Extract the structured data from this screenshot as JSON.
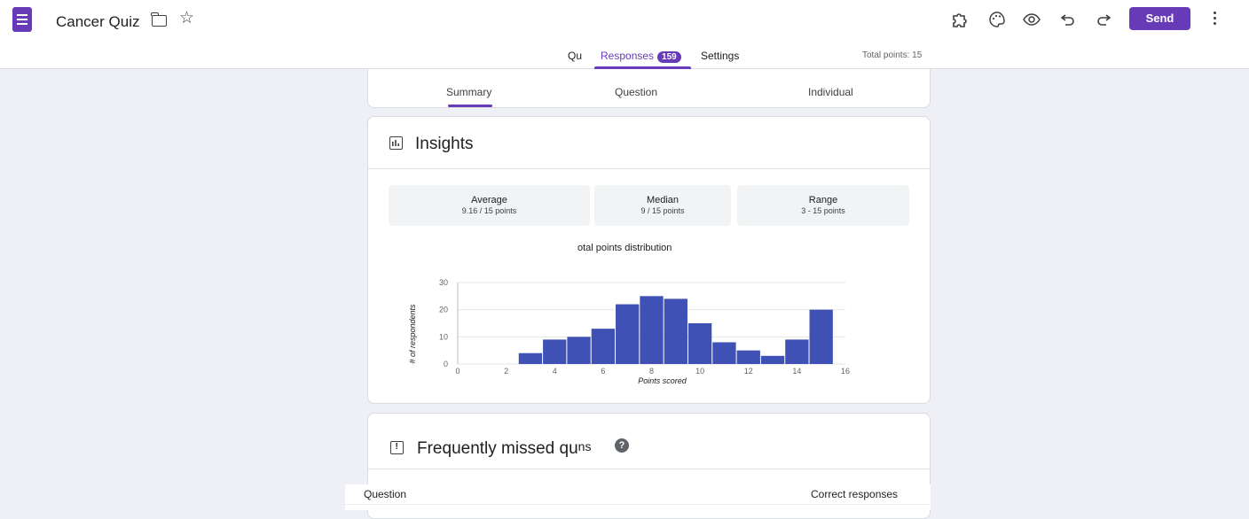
{
  "header": {
    "doc_title": "Cancer Quiz",
    "send_label": "Send"
  },
  "tabs": {
    "questions_label": "Qu",
    "responses_label": "Responses",
    "responses_count": "159",
    "settings_label": "Settings",
    "total_points": "Total points: 15"
  },
  "subtabs": {
    "summary": "Summary",
    "question": "Question",
    "individual": "Individual"
  },
  "insights": {
    "title": "Insights",
    "stats": [
      {
        "label": "Average",
        "value": "9.16 / 15 points"
      },
      {
        "label": "Median",
        "value": "9 / 15 points"
      },
      {
        "label": "Range",
        "value": "3 - 15 points"
      }
    ],
    "chart_title": "otal points distribution"
  },
  "missed": {
    "title": "Frequently missed qu",
    "title_tail": "ns",
    "help_glyph": "?",
    "col_question": "Question",
    "col_correct": "Correct responses"
  },
  "chart_data": {
    "type": "bar",
    "title": "otal points distribution",
    "xlabel": "Points scored",
    "ylabel": "# of respondents",
    "x": [
      3,
      4,
      5,
      6,
      7,
      8,
      9,
      10,
      11,
      12,
      13,
      14,
      15
    ],
    "values": [
      4,
      9,
      10,
      13,
      22,
      25,
      24,
      15,
      8,
      5,
      3,
      9,
      20
    ],
    "xlim": [
      0,
      16
    ],
    "ylim": [
      0,
      30
    ],
    "x_ticks": [
      0,
      2,
      4,
      6,
      8,
      10,
      12,
      14,
      16
    ],
    "y_ticks": [
      0,
      10,
      20,
      30
    ],
    "bar_color": "#3f51b5"
  }
}
